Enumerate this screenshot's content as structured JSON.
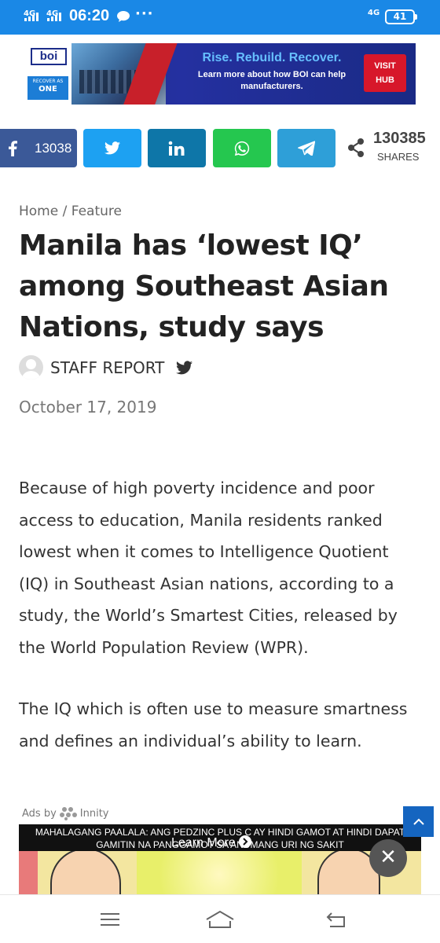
{
  "status_bar": {
    "network_left_1": "4G",
    "network_left_2": "4G",
    "time": "06:20",
    "more": "···",
    "network_right": "4G",
    "battery": "41"
  },
  "banner_ad": {
    "logo": "boi",
    "logo_badge_small": "RECOVER AS",
    "logo_badge_big": "ONE",
    "headline": "Rise. Rebuild. Recover.",
    "subline": "Learn more about how BOI can help manufacturers.",
    "cta": "VISIT HUB"
  },
  "share_bar": {
    "facebook_count": "13038",
    "total_count": "130385",
    "total_label": "SHARES",
    "icons": [
      "facebook-icon",
      "twitter-icon",
      "linkedin-icon",
      "whatsapp-icon",
      "telegram-icon",
      "share-icon"
    ],
    "colors": {
      "facebook": "#3b5998",
      "twitter": "#1da1f2",
      "linkedin": "#0e76a8",
      "whatsapp": "#25c74f",
      "telegram": "#2e9fd8"
    }
  },
  "article": {
    "breadcrumb": {
      "home": "Home",
      "separator": "/",
      "section": "Feature"
    },
    "title": "Manila has ‘lowest IQ’ among Southeast Asian Nations, study says",
    "author": "STAFF REPORT",
    "date": "October 17, 2019",
    "paragraphs": [
      "Because of high poverty incidence and poor access to education, Manila residents ranked lowest when it comes to Intelligence Quotient (IQ) in Southeast Asian nations, according to a study, the World’s Smartest Cities, released by the World Population Review (WPR).",
      "The IQ which is often use to measure smartness and defines an individual’s ability to learn."
    ]
  },
  "inline_ad": {
    "ads_by": "Ads by",
    "provider": "Innity",
    "notice": "MAHALAGANG PAALALA: ANG PEDZINC PLUS C AY HINDI GAMOT AT HINDI DAPAT GAMITIN NA PANGGAMOT SA ANUMANG URI NG SAKIT",
    "learn_more": "Learn More",
    "close": "✕"
  },
  "accent_color": "#1a88e6"
}
